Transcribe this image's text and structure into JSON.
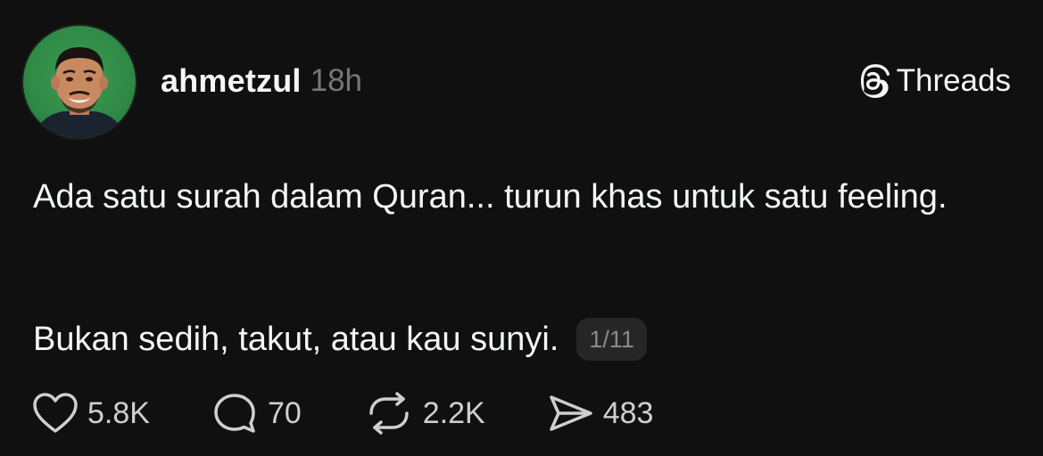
{
  "post": {
    "avatar_icon": "avatar-photo",
    "username": "ahmetzul",
    "timestamp": "18h",
    "brand": {
      "icon": "threads-logo-icon",
      "label": "Threads"
    },
    "paragraph1": "Ada satu surah dalam Quran... turun khas untuk satu feeling.",
    "paragraph2": "Bukan sedih, takut, atau kau sunyi.",
    "thread_counter": "1/11",
    "actions": {
      "likes": {
        "icon": "heart-icon",
        "count": "5.8K"
      },
      "replies": {
        "icon": "comment-icon",
        "count": "70"
      },
      "reposts": {
        "icon": "repost-icon",
        "count": "2.2K"
      },
      "shares": {
        "icon": "share-icon",
        "count": "483"
      }
    }
  },
  "colors": {
    "background": "#101010",
    "text_primary": "#f3f5f7",
    "text_secondary": "#777777",
    "badge_bg": "#262626",
    "avatar_bg": "#2f8a45"
  }
}
